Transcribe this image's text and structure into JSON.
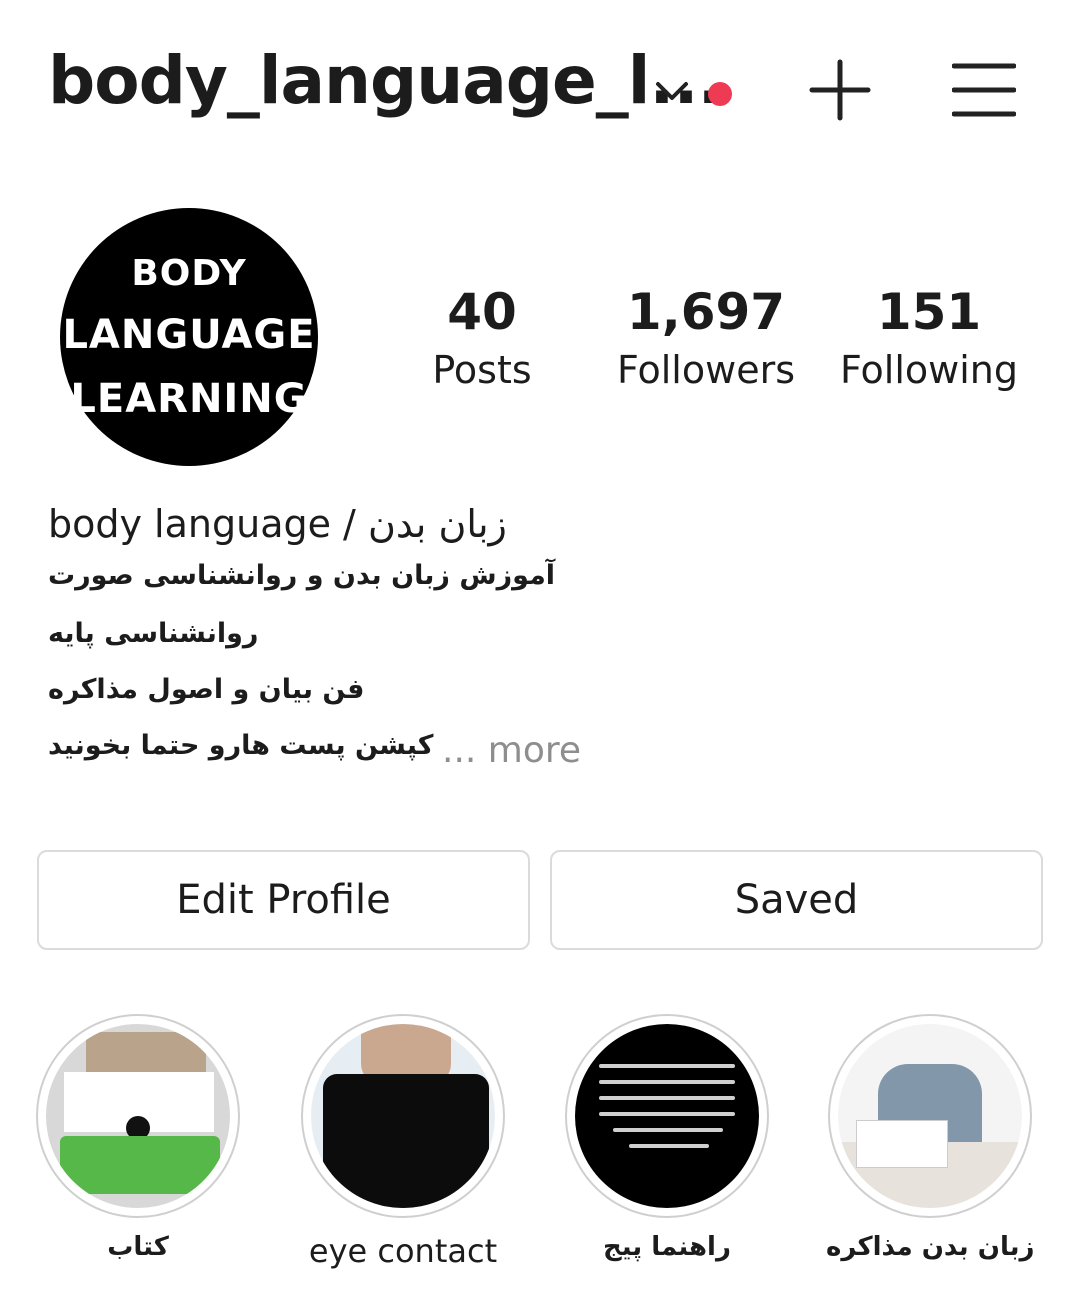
{
  "header": {
    "username": "body_language_l...",
    "switch_account_icon": "chevron-down-icon",
    "notification_dot_color": "#ef3a53",
    "create_icon": "plus-icon",
    "menu_icon": "hamburger-menu-icon"
  },
  "profile": {
    "avatar_lines": [
      "BODY",
      "LANGUAGE",
      "LEARNING"
    ],
    "stats": [
      {
        "value": "40",
        "label": "Posts"
      },
      {
        "value": "1,697",
        "label": "Followers"
      },
      {
        "value": "151",
        "label": "Following"
      }
    ]
  },
  "bio": {
    "name": "body language / زبان بدن",
    "lines": [
      "آموزش زبان بدن و روانشناسی صورت",
      "روانشناسی پایه",
      "فن بیان و اصول مذاکره",
      "کپشن پست هارو حتما بخونید"
    ],
    "more_label": "... more"
  },
  "buttons": {
    "edit_profile": "Edit Profile",
    "saved": "Saved"
  },
  "highlights": [
    {
      "label": "کتاب"
    },
    {
      "label": "eye contact"
    },
    {
      "label": "راهنما پیج"
    },
    {
      "label": "زبان بدن مذاکره"
    }
  ]
}
